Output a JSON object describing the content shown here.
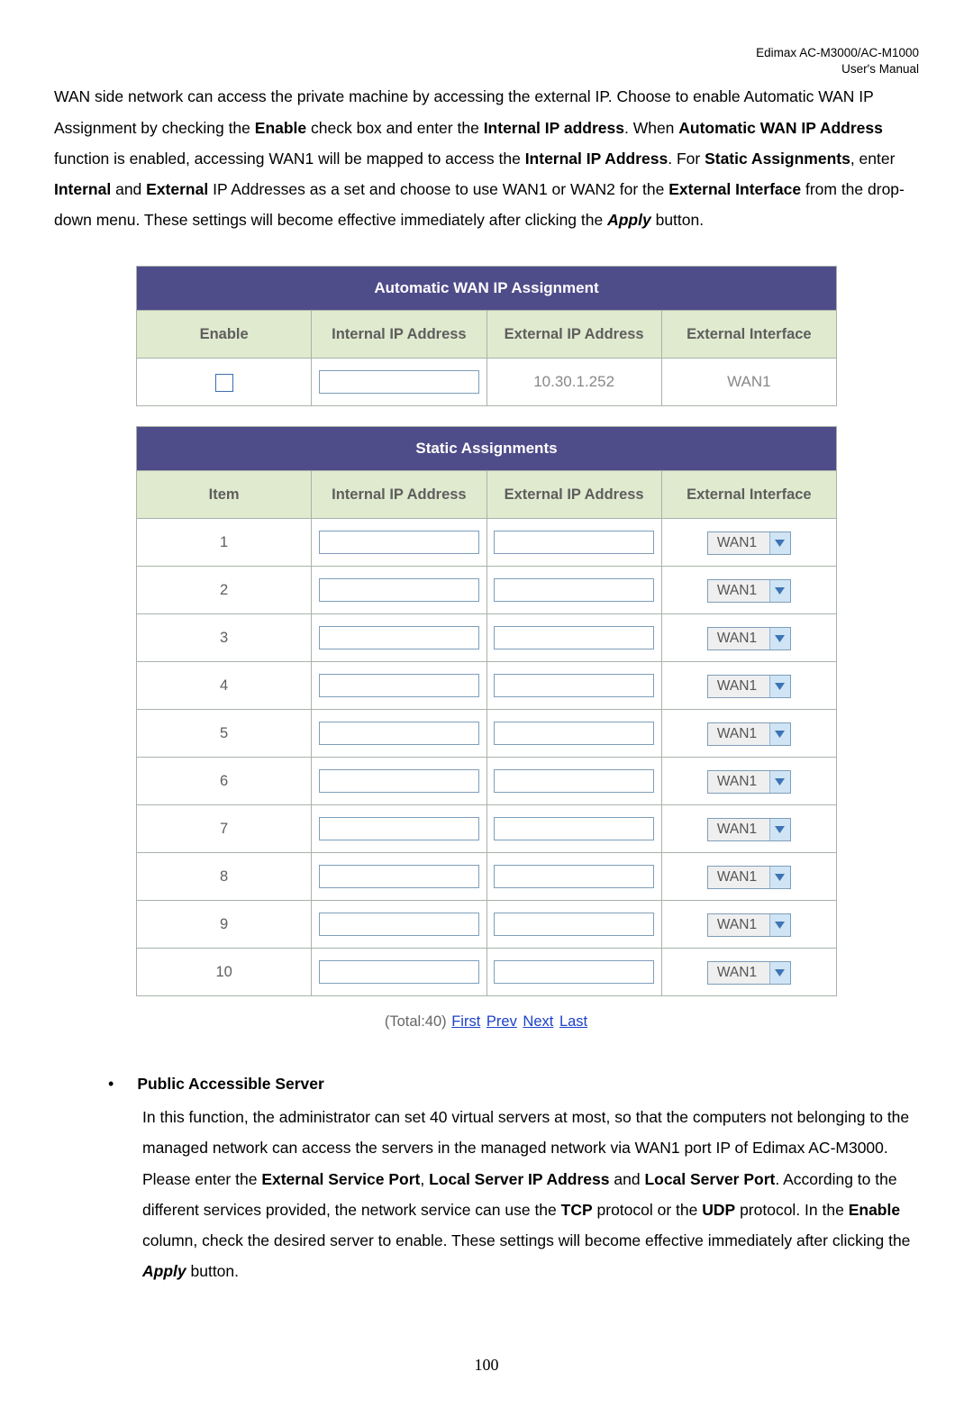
{
  "header": {
    "line1": "Edimax AC-M3000/AC-M1000",
    "line2": "User's Manual"
  },
  "intro": {
    "segments": [
      {
        "t": "WAN side network can access the private machine by accessing the external IP. Choose to enable Automatic WAN IP Assignment by checking the "
      },
      {
        "t": "Enable",
        "b": true
      },
      {
        "t": " check box and enter the "
      },
      {
        "t": "Internal IP address",
        "b": true
      },
      {
        "t": ". When "
      },
      {
        "t": "Automatic WAN IP Address",
        "b": true
      },
      {
        "t": " function is enabled, accessing WAN1 will be mapped to access the "
      },
      {
        "t": "Internal IP Address",
        "b": true
      },
      {
        "t": ". For "
      },
      {
        "t": "Static Assignments",
        "b": true
      },
      {
        "t": ", enter "
      },
      {
        "t": "Internal",
        "b": true
      },
      {
        "t": " and "
      },
      {
        "t": "External",
        "b": true
      },
      {
        "t": " IP Addresses as a set and choose to use WAN1 or WAN2 for the "
      },
      {
        "t": "External Interface",
        "b": true
      },
      {
        "t": " from the drop-down menu. These settings will become effective immediately after clicking the "
      },
      {
        "t": "Apply",
        "b": true,
        "i": true
      },
      {
        "t": " button."
      }
    ]
  },
  "auto_table": {
    "title": "Automatic WAN IP Assignment",
    "headers": {
      "enable": "Enable",
      "internal": "Internal IP Address",
      "external": "External IP Address",
      "iface": "External Interface"
    },
    "row": {
      "enable_checked": false,
      "internal": "",
      "external": "10.30.1.252",
      "iface": "WAN1"
    }
  },
  "static_table": {
    "title": "Static Assignments",
    "headers": {
      "item": "Item",
      "internal": "Internal IP Address",
      "external": "External IP Address",
      "iface": "External Interface"
    },
    "rows": [
      {
        "item": "1",
        "internal": "",
        "external": "",
        "iface": "WAN1"
      },
      {
        "item": "2",
        "internal": "",
        "external": "",
        "iface": "WAN1"
      },
      {
        "item": "3",
        "internal": "",
        "external": "",
        "iface": "WAN1"
      },
      {
        "item": "4",
        "internal": "",
        "external": "",
        "iface": "WAN1"
      },
      {
        "item": "5",
        "internal": "",
        "external": "",
        "iface": "WAN1"
      },
      {
        "item": "6",
        "internal": "",
        "external": "",
        "iface": "WAN1"
      },
      {
        "item": "7",
        "internal": "",
        "external": "",
        "iface": "WAN1"
      },
      {
        "item": "8",
        "internal": "",
        "external": "",
        "iface": "WAN1"
      },
      {
        "item": "9",
        "internal": "",
        "external": "",
        "iface": "WAN1"
      },
      {
        "item": "10",
        "internal": "",
        "external": "",
        "iface": "WAN1"
      }
    ]
  },
  "pager": {
    "total_text": "(Total:40)",
    "first": "First",
    "prev": "Prev",
    "next": "Next",
    "last": "Last"
  },
  "section2": {
    "bullet_title": "Public Accessible Server",
    "segments": [
      {
        "t": "In this function, the administrator can set 40 virtual servers at most, so that the computers not belonging to the managed network can access the servers in the managed network via WAN1 port IP of Edimax AC-M3000. Please enter the "
      },
      {
        "t": "External Service Port",
        "b": true
      },
      {
        "t": ", "
      },
      {
        "t": "Local Server IP Address",
        "b": true
      },
      {
        "t": " and "
      },
      {
        "t": "Local Server Port",
        "b": true
      },
      {
        "t": ". According to the different services provided, the network service can use the "
      },
      {
        "t": "TCP",
        "b": true
      },
      {
        "t": " protocol or the "
      },
      {
        "t": "UDP",
        "b": true
      },
      {
        "t": " protocol. In the "
      },
      {
        "t": "Enable",
        "b": true
      },
      {
        "t": " column, check the desired server to enable. These settings will become effective immediately after clicking the "
      },
      {
        "t": "Apply",
        "b": true,
        "i": true
      },
      {
        "t": " button."
      }
    ]
  },
  "page_number": "100"
}
